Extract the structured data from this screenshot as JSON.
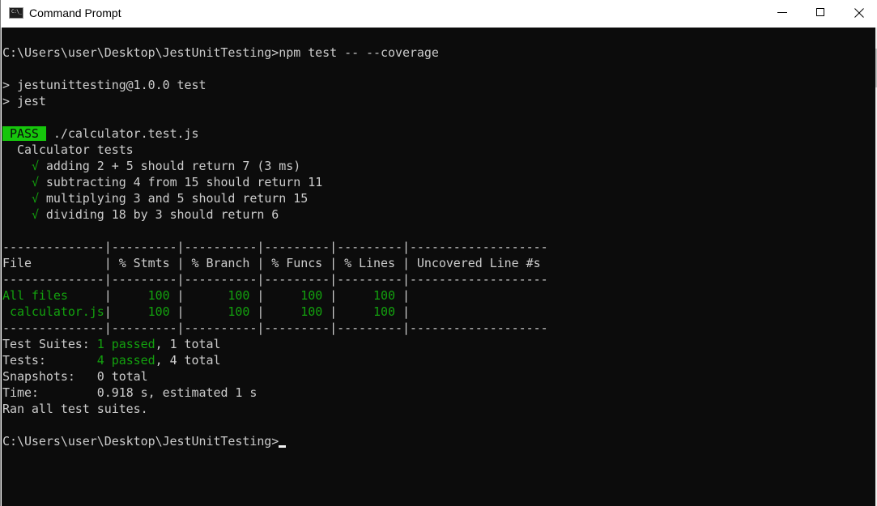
{
  "window": {
    "title": "Command Prompt",
    "icon": "cmd-icon",
    "icon_text": "C:\\_",
    "controls": [
      "minimize",
      "maximize",
      "close"
    ]
  },
  "terminal": {
    "prompt": "C:\\Users\\user\\Desktop\\JestUnitTesting>",
    "command": "npm test -- --coverage",
    "npm_script_line": "> jestunittesting@1.0.0 test",
    "npm_cmd_line": "> jest",
    "pass_badge": " PASS ",
    "test_file": " ./calculator.test.js",
    "suite_name": "  Calculator tests",
    "check_glyph": "√",
    "tests": [
      {
        "status": "passed",
        "name": "adding 2 + 5 should return 7 (3 ms)"
      },
      {
        "status": "passed",
        "name": "subtracting 4 from 15 should return 11"
      },
      {
        "status": "passed",
        "name": "multiplying 3 and 5 should return 15"
      },
      {
        "status": "passed",
        "name": "dividing 18 by 3 should return 6"
      }
    ],
    "coverage_table": {
      "separator": "--------------|---------|----------|---------|---------|-------------------",
      "header": "File          | % Stmts | % Branch | % Funcs | % Lines | Uncovered Line #s ",
      "columns": [
        "File",
        "% Stmts",
        "% Branch",
        "% Funcs",
        "% Lines",
        "Uncovered Line #s"
      ],
      "rows": [
        {
          "file": "All files",
          "stmts": "100",
          "branch": "100",
          "funcs": "100",
          "lines": "100",
          "uncovered": ""
        },
        {
          "file": " calculator.js",
          "stmts": "100",
          "branch": "100",
          "funcs": "100",
          "lines": "100",
          "uncovered": ""
        }
      ]
    },
    "summary": {
      "suites_label": "Test Suites: ",
      "suites_passed": "1 passed",
      "suites_total": ", 1 total",
      "tests_label": "Tests:       ",
      "tests_passed": "4 passed",
      "tests_total": ", 4 total",
      "snapshots_label": "Snapshots:   ",
      "snapshots_value": "0 total",
      "time_label": "Time:        ",
      "time_value": "0.918 s, estimated 1 s",
      "ran_all": "Ran all test suites."
    }
  }
}
